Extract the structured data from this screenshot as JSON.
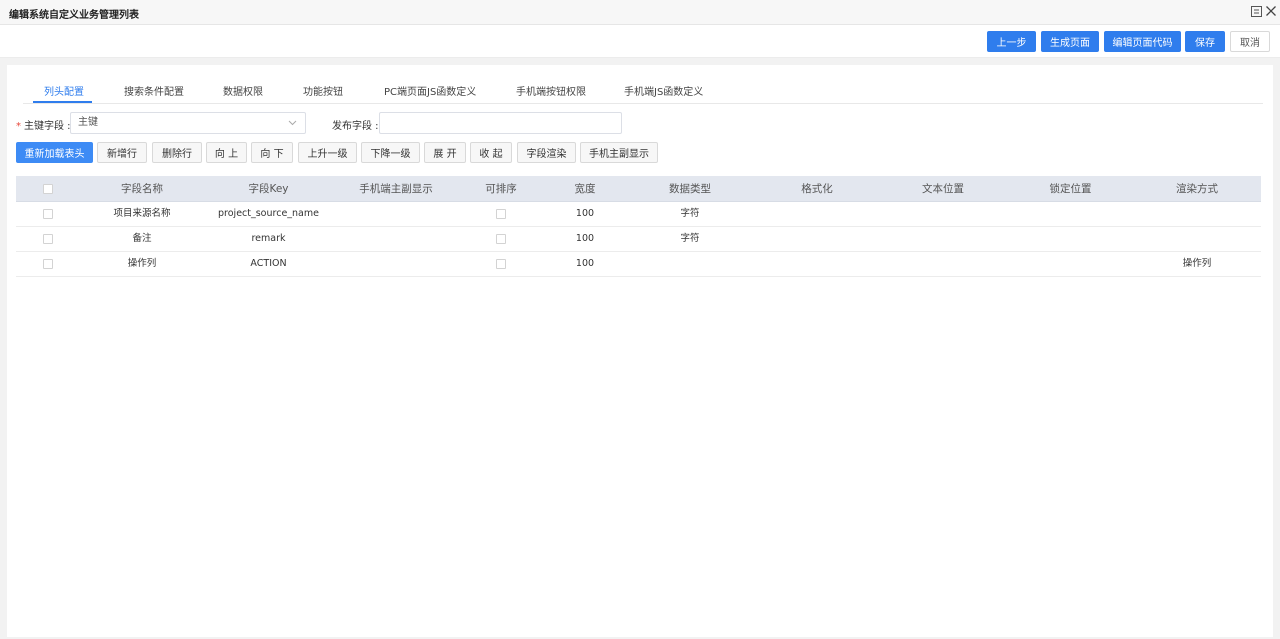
{
  "window": {
    "title": "编辑系统自定义业务管理列表"
  },
  "actions": {
    "prev": "上一步",
    "generate": "生成页面",
    "edit_code": "编辑页面代码",
    "save": "保存",
    "cancel": "取消"
  },
  "tabs": [
    {
      "label": "列头配置",
      "active": true
    },
    {
      "label": "搜索条件配置",
      "active": false
    },
    {
      "label": "数据权限",
      "active": false
    },
    {
      "label": "功能按钮",
      "active": false
    },
    {
      "label": "PC端页面JS函数定义",
      "active": false
    },
    {
      "label": "手机端按钮权限",
      "active": false
    },
    {
      "label": "手机端JS函数定义",
      "active": false
    }
  ],
  "form": {
    "primary_key_label": "主键字段 :",
    "primary_key_value": "主键",
    "publish_label": "发布字段 :",
    "publish_value": ""
  },
  "toolbar": [
    "重新加载表头",
    "新增行",
    "删除行",
    "向 上",
    "向 下",
    "上升一级",
    "下降一级",
    "展 开",
    "收 起",
    "字段渲染",
    "手机主副显示"
  ],
  "table": {
    "columns": [
      "字段名称",
      "字段Key",
      "手机端主副显示",
      "可排序",
      "宽度",
      "数据类型",
      "格式化",
      "文本位置",
      "锁定位置",
      "渲染方式"
    ],
    "rows": [
      {
        "name": "项目来源名称",
        "key": "project_source_name",
        "width": "100",
        "type": "字符",
        "render": ""
      },
      {
        "name": "备注",
        "key": "remark",
        "width": "100",
        "type": "字符",
        "render": ""
      },
      {
        "name": "操作列",
        "key": "ACTION",
        "width": "100",
        "type": "",
        "render": "操作列"
      }
    ]
  },
  "colors": {
    "primary": "#2f7ded",
    "header_bg": "#e3e7ef",
    "required": "#e8473a"
  }
}
